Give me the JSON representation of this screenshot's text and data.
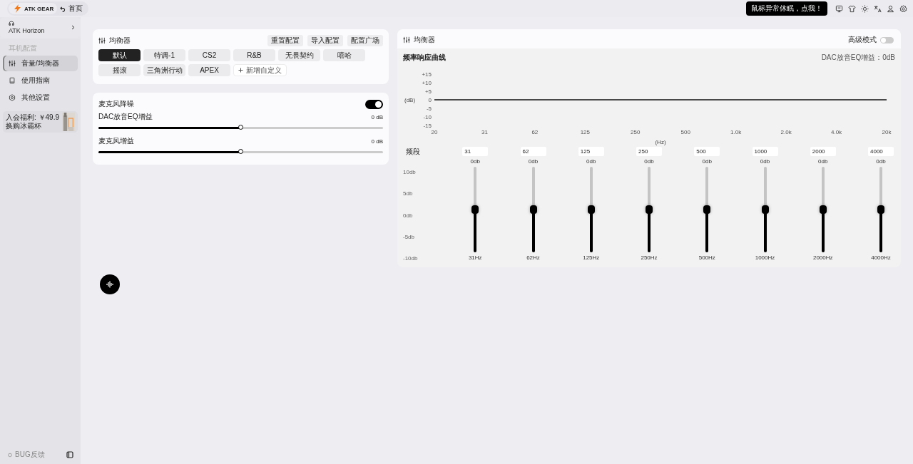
{
  "topbar": {
    "brand": "ATK GEAR",
    "home": "首页",
    "notice": "鼠标异常休眠，点我！"
  },
  "sidebar": {
    "device": "ATK Horizon",
    "section": "耳机配置",
    "items": [
      {
        "label": "音量/均衡器",
        "selected": true
      },
      {
        "label": "使用指南",
        "selected": false
      },
      {
        "label": "其他设置",
        "selected": false
      }
    ],
    "promo": "入会福利: ￥49.9换购冰霸杯",
    "feedback": "BUG反馈"
  },
  "equalizer": {
    "title": "均衡器",
    "actions": [
      "重置配置",
      "导入配置",
      "配置广场"
    ],
    "presets": [
      {
        "label": "默认",
        "selected": true
      },
      {
        "label": "特调-1",
        "selected": false
      },
      {
        "label": "CS2",
        "selected": false
      },
      {
        "label": "R&B",
        "selected": false
      },
      {
        "label": "无畏契约",
        "selected": false
      },
      {
        "label": "嘻哈",
        "selected": false
      },
      {
        "label": "摇滚",
        "selected": false
      },
      {
        "label": "三角洲行动",
        "selected": false
      },
      {
        "label": "APEX",
        "selected": false
      }
    ],
    "add": "新增自定义"
  },
  "mic": {
    "noise_label": "麦克风降噪",
    "noise_on": true,
    "sliders": [
      {
        "label": "DAC放音EQ增益",
        "reading": "0 dB",
        "level": 0.5
      },
      {
        "label": "麦克风增益",
        "reading": "0 dB",
        "level": 0.5
      }
    ]
  },
  "eq_panel": {
    "title": "均衡器",
    "advanced_label": "高级模式",
    "advanced_on": false,
    "dac_note": "DAC放音EQ增益：0dB",
    "chart_data": {
      "type": "line",
      "title": "频率响应曲线",
      "xlabel": "(Hz)",
      "ylabel": "(dB)",
      "categories": [
        "20",
        "31",
        "62",
        "125",
        "250",
        "500",
        "1.0k",
        "2.0k",
        "4.0k",
        "20k"
      ],
      "series": [
        {
          "color": "#111111",
          "values": [
            0,
            0,
            0,
            0,
            0,
            0,
            0,
            0,
            0,
            0
          ]
        }
      ],
      "ylim": [
        -15,
        15
      ],
      "yticks": [
        {
          "value": 15,
          "label": "+15"
        },
        {
          "value": 10,
          "label": "+10"
        },
        {
          "value": 5,
          "label": "+5"
        },
        0,
        -5,
        -10,
        -15
      ]
    },
    "band_label": "频段",
    "scale": [
      "10db",
      "5db",
      "0db",
      "-5db",
      "-10db"
    ],
    "bands": [
      {
        "freq": "31",
        "reading": "0db",
        "label": "31Hz",
        "level": 0.5
      },
      {
        "freq": "62",
        "reading": "0db",
        "label": "62Hz",
        "level": 0.5
      },
      {
        "freq": "125",
        "reading": "0db",
        "label": "125Hz",
        "level": 0.5
      },
      {
        "freq": "250",
        "reading": "0db",
        "label": "250Hz",
        "level": 0.5
      },
      {
        "freq": "500",
        "reading": "0db",
        "label": "500Hz",
        "level": 0.5
      },
      {
        "freq": "1000",
        "reading": "0db",
        "label": "1000Hz",
        "level": 0.5
      },
      {
        "freq": "2000",
        "reading": "0db",
        "label": "2000Hz",
        "level": 0.5
      },
      {
        "freq": "4000",
        "reading": "0db",
        "label": "4000Hz",
        "level": 0.5
      }
    ]
  }
}
